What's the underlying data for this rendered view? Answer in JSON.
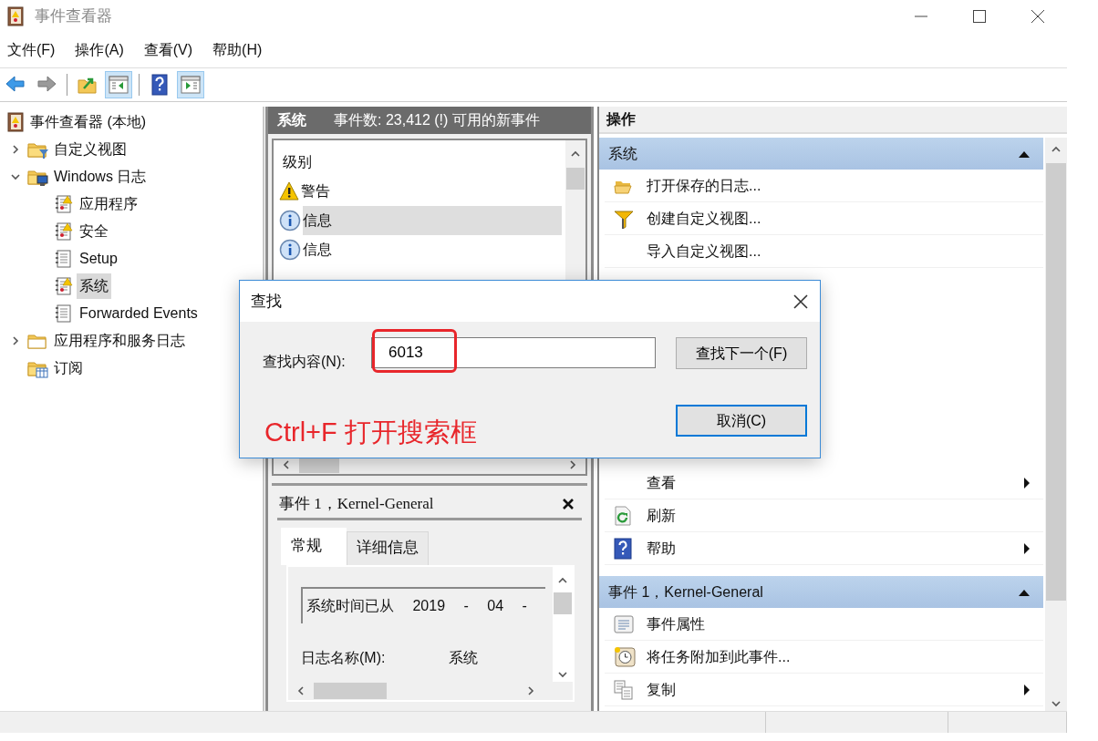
{
  "window": {
    "title": "事件查看器"
  },
  "menu": [
    "文件(F)",
    "操作(A)",
    "查看(V)",
    "帮助(H)"
  ],
  "toolbar": [
    {
      "kind": "back",
      "pressed": false
    },
    {
      "kind": "forward",
      "pressed": false
    },
    {
      "kind": "separator"
    },
    {
      "kind": "up",
      "pressed": false
    },
    {
      "kind": "tree_pane",
      "pressed": true
    },
    {
      "kind": "separator"
    },
    {
      "kind": "help",
      "pressed": false
    },
    {
      "kind": "action_pane",
      "pressed": true
    }
  ],
  "tree": [
    {
      "label": "事件查看器 (本地)",
      "kind": "root",
      "selected": false,
      "children": [
        {
          "label": "自定义视图",
          "kind": "folder_filter",
          "expanded": false,
          "selected": false
        },
        {
          "label": "Windows 日志",
          "kind": "folder_computer",
          "expanded": true,
          "selected": false,
          "children": [
            {
              "label": "应用程序",
              "kind": "log_warn",
              "selected": false
            },
            {
              "label": "安全",
              "kind": "log_warn",
              "selected": false
            },
            {
              "label": "Setup",
              "kind": "log",
              "selected": false
            },
            {
              "label": "系统",
              "kind": "log_warn",
              "selected": true
            },
            {
              "label": "Forwarded Events",
              "kind": "log",
              "selected": false
            }
          ]
        },
        {
          "label": "应用程序和服务日志",
          "kind": "folder",
          "expanded": false,
          "selected": false
        },
        {
          "label": "订阅",
          "kind": "subscription",
          "selected": false
        }
      ]
    }
  ],
  "events": {
    "title": "系统",
    "summary": "事件数: 23,412 (!) 可用的新事件",
    "columns": [
      "级别"
    ],
    "rows": [
      {
        "kind": "warning",
        "label": "警告",
        "selected": false
      },
      {
        "kind": "info",
        "label": "信息",
        "selected": true
      },
      {
        "kind": "info",
        "label": "信息",
        "selected": false
      }
    ]
  },
  "detail": {
    "title": "事件 1，Kernel-General",
    "tabs": [
      {
        "label": "常规",
        "selected": true
      },
      {
        "label": "详细信息",
        "selected": false
      }
    ],
    "message": "系统时间已从 2019 - 04 -",
    "fields": [
      {
        "label": "日志名称(M):",
        "value": "系统"
      }
    ]
  },
  "actions": {
    "title": "操作",
    "sections": [
      {
        "title": "系统",
        "expanded": true,
        "items": [
          {
            "label": "打开保存的日志...",
            "kind": "open_folder",
            "submenu": false
          },
          {
            "label": "创建自定义视图...",
            "kind": "funnel",
            "submenu": false
          },
          {
            "label": "导入自定义视图...",
            "submenu": false
          },
          {
            "label": "查看",
            "submenu": true
          },
          {
            "label": "刷新",
            "kind": "refresh",
            "submenu": false
          },
          {
            "label": "帮助",
            "kind": "help",
            "submenu": true
          }
        ]
      },
      {
        "title": "事件 1，Kernel-General",
        "expanded": true,
        "items": [
          {
            "label": "事件属性",
            "kind": "properties",
            "submenu": false
          },
          {
            "label": "将任务附加到此事件...",
            "kind": "task",
            "submenu": false
          },
          {
            "label": "复制",
            "kind": "copy",
            "submenu": true
          }
        ]
      }
    ]
  },
  "find_dialog": {
    "title": "查找",
    "label": "查找内容(N):",
    "value": "6013",
    "buttons": [
      {
        "label": "查找下一个(F)",
        "default": false
      },
      {
        "label": "取消(C)",
        "default": true
      }
    ],
    "highlight": true
  },
  "annotation": "Ctrl+F 打开搜索框"
}
